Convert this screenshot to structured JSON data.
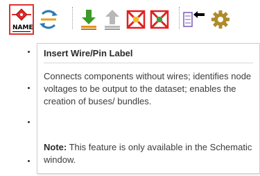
{
  "toolbar": {
    "tools": [
      {
        "name": "insert-wire-pin-label-button",
        "icon": "name-label-icon",
        "label": "NAME",
        "selected": true
      },
      {
        "name": "net-connect-button",
        "icon": "net-connect-icon"
      },
      {
        "name": "move-down-button",
        "icon": "arrow-down-icon"
      },
      {
        "name": "move-up-button",
        "icon": "arrow-up-icon"
      },
      {
        "name": "disable-component-button",
        "icon": "red-x-icon"
      },
      {
        "name": "disable-component-alt-button",
        "icon": "red-x-alt-icon"
      },
      {
        "name": "subcircuit-button",
        "icon": "subcircuit-icon"
      },
      {
        "name": "settings-button",
        "icon": "gear-icon"
      }
    ],
    "name_label": "NAME"
  },
  "tooltip": {
    "title": "Insert Wire/Pin Label",
    "body": "Connects components without wires; identifies node voltages to be output to the dataset; enables the creation of buses/ bundles.",
    "note_label": "Note:",
    "note_text": " This feature is only available in the Schematic window."
  },
  "colors": {
    "selection_border": "#e03030",
    "arrow_green": "#3a9a2a",
    "arrow_orange": "#e8901a",
    "red_x": "#e02020"
  }
}
